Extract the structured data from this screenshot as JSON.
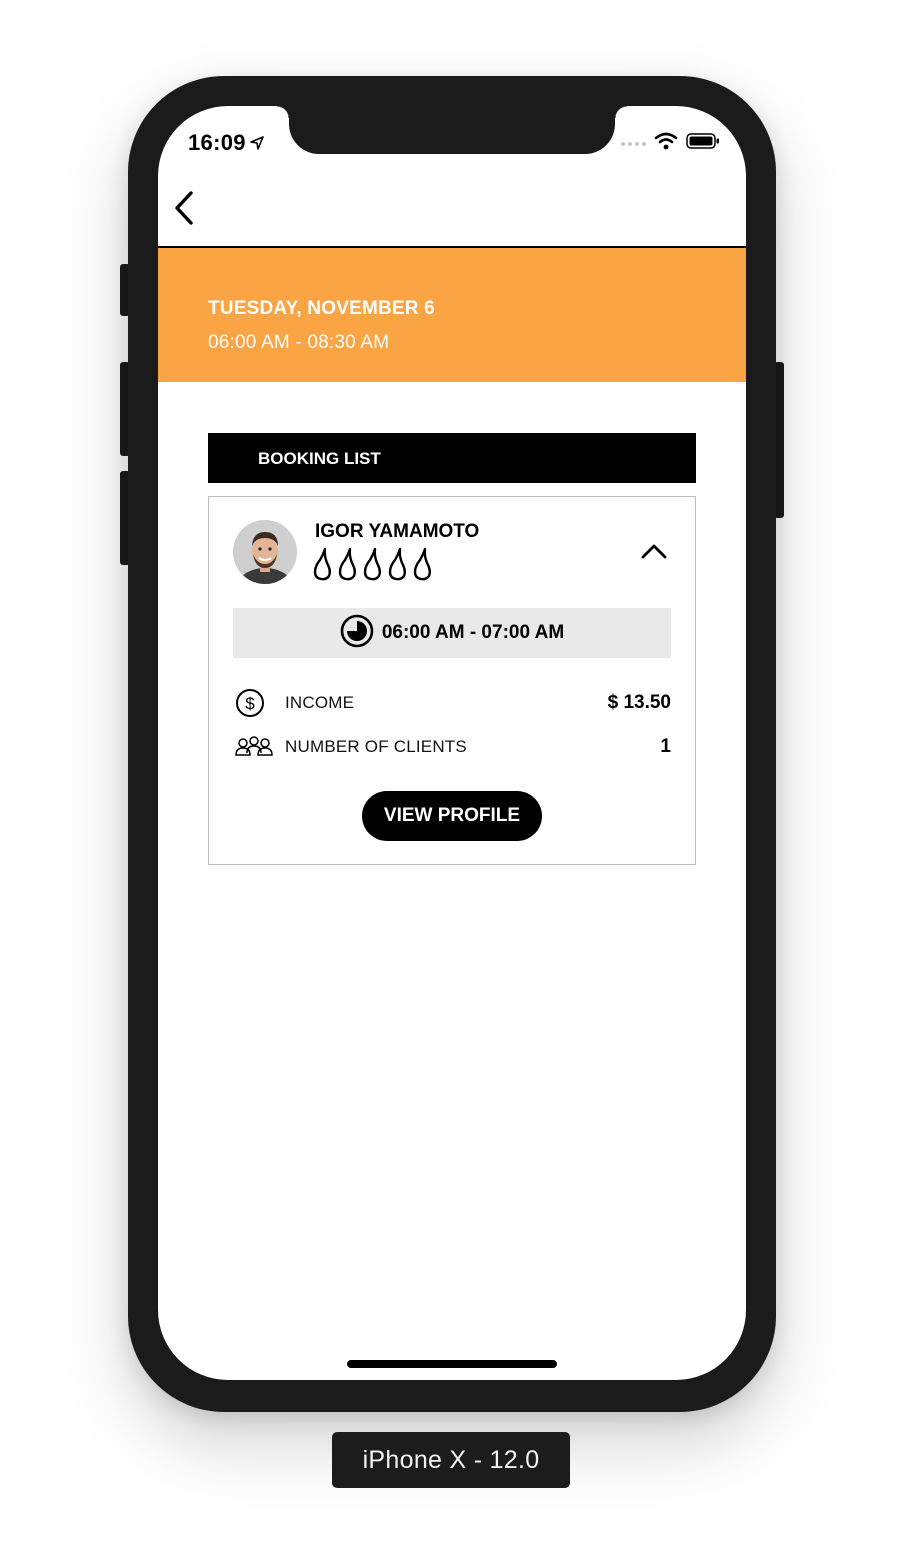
{
  "status_bar": {
    "time": "16:09"
  },
  "header": {
    "date_title": "TUESDAY, NOVEMBER 6",
    "time_range": "06:00 AM - 08:30 AM"
  },
  "booking_list": {
    "title": "BOOKING LIST",
    "items": [
      {
        "client_name": "IGOR YAMAMOTO",
        "rating": 5,
        "rating_max": 5,
        "time_slot": "06:00 AM - 07:00 AM",
        "income_label": "INCOME",
        "income_value": "$ 13.50",
        "clients_label": "NUMBER OF CLIENTS",
        "clients_value": "1",
        "view_profile_label": "VIEW PROFILE"
      }
    ]
  },
  "device_caption": "iPhone X - 12.0",
  "colors": {
    "accent": "#fba443",
    "dark": "#000000",
    "slot_bg": "#e9e9e9"
  },
  "icons": {
    "back": "chevron-left-icon",
    "collapse": "chevron-up-icon",
    "rating": "drop-icon",
    "clock": "clock-icon",
    "income": "dollar-circle-icon",
    "clients": "group-icon"
  }
}
